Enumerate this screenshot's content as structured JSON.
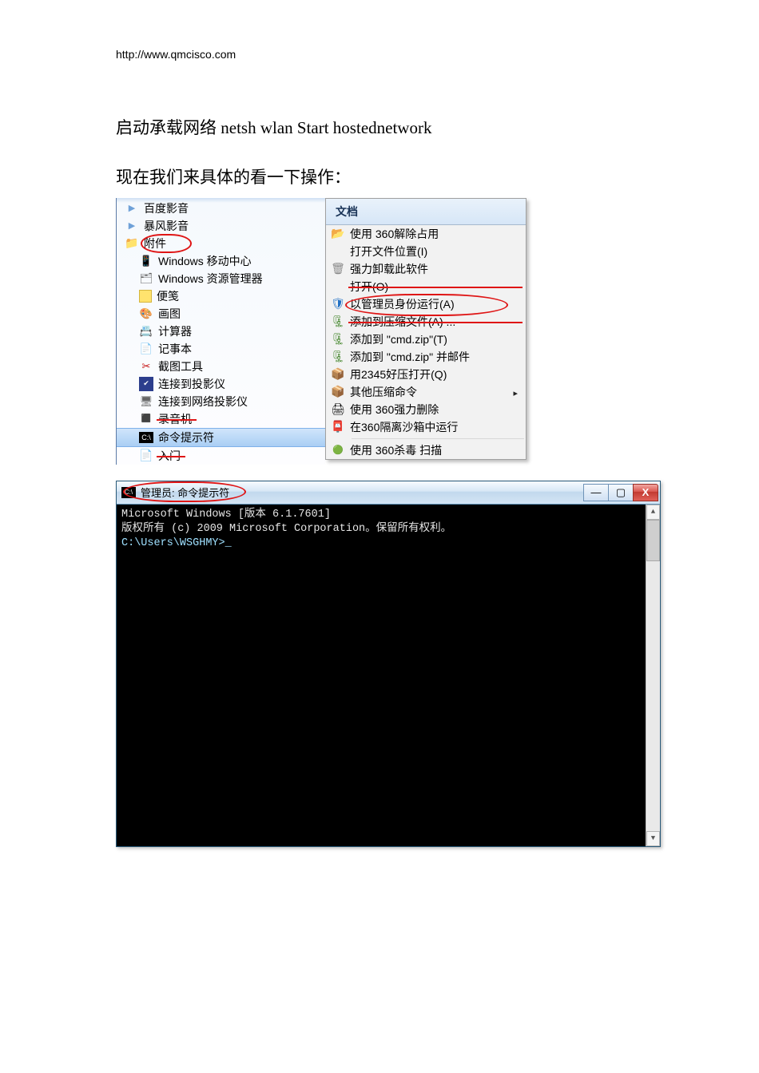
{
  "page": {
    "url": "http://www.qmcisco.com",
    "heading": "启动承载网络 netsh wlan Start hostednetwork",
    "sub": "现在我们来具体的看一下操作："
  },
  "startmenu": {
    "items": [
      {
        "label": "百度影音",
        "kind": "media"
      },
      {
        "label": "暴风影音",
        "kind": "media"
      },
      {
        "label": "附件",
        "kind": "folder",
        "circled": true
      },
      {
        "label": "Windows 移动中心",
        "kind": "mobile",
        "indent": true
      },
      {
        "label": "Windows 资源管理器",
        "kind": "explorer",
        "indent": true
      },
      {
        "label": "便笺",
        "kind": "note",
        "indent": true
      },
      {
        "label": "画图",
        "kind": "paint",
        "indent": true
      },
      {
        "label": "计算器",
        "kind": "calc",
        "indent": true
      },
      {
        "label": "记事本",
        "kind": "notepad",
        "indent": true
      },
      {
        "label": "截图工具",
        "kind": "snip",
        "indent": true
      },
      {
        "label": "连接到投影仪",
        "kind": "proj",
        "indent": true
      },
      {
        "label": "连接到网络投影仪",
        "kind": "netproj",
        "indent": true
      },
      {
        "label": "录音机",
        "kind": "rec",
        "indent": true,
        "strike": true
      },
      {
        "label": "命令提示符",
        "kind": "cmd",
        "indent": true,
        "selected": true
      },
      {
        "label": "入门",
        "kind": "misc",
        "indent": true,
        "strike": true
      }
    ]
  },
  "context": {
    "header": "文档",
    "groups": [
      [
        {
          "label": "使用 360解除占用",
          "icon": "open"
        },
        {
          "label": "打开文件位置(I)",
          "icon": ""
        },
        {
          "label": "强力卸载此软件",
          "icon": "trash"
        },
        {
          "label": "打开(O)",
          "icon": "",
          "strike": true
        },
        {
          "label": "以管理员身份运行(A)",
          "icon": "shield",
          "circled": true
        },
        {
          "label": "添加到压缩文件(A) ...",
          "icon": "zip",
          "strike": true
        },
        {
          "label": "添加到 \"cmd.zip\"(T)",
          "icon": "zip"
        },
        {
          "label": "添加到 \"cmd.zip\" 并邮件",
          "icon": "zip"
        },
        {
          "label": "用2345好压打开(Q)",
          "icon": "zip2"
        },
        {
          "label": "其他压缩命令",
          "icon": "zip2",
          "submenu": true
        },
        {
          "label": "使用 360强力删除",
          "icon": "print"
        },
        {
          "label": "在360隔离沙箱中运行",
          "icon": "box"
        }
      ],
      [
        {
          "label": "使用 360杀毒 扫描",
          "icon": "scan"
        }
      ]
    ]
  },
  "cmd": {
    "title": "管理员: 命令提示符",
    "buttons": {
      "min": "—",
      "max": "▢",
      "close": "X"
    },
    "lines": [
      "Microsoft Windows [版本 6.1.7601]",
      "版权所有 (c) 2009 Microsoft Corporation。保留所有权利。",
      "",
      "C:\\Users\\WSGHMY>"
    ]
  }
}
